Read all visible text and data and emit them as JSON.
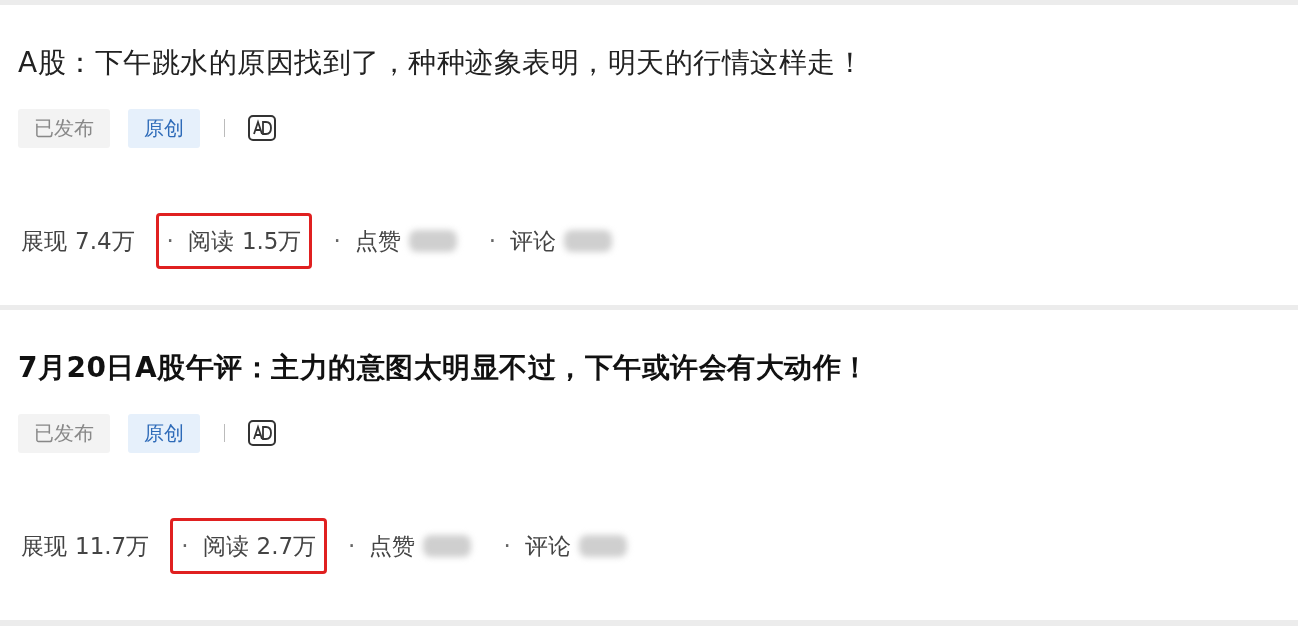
{
  "articles": [
    {
      "title": "A股：下午跳水的原因找到了，种种迹象表明，明天的行情这样走！",
      "bold": false,
      "tags": [
        {
          "label": "已发布",
          "kind": "status"
        },
        {
          "label": "原创",
          "kind": "original"
        }
      ],
      "ad": true,
      "stats": [
        {
          "label": "展现",
          "value": "7.4万",
          "highlighted": false,
          "blurred": false
        },
        {
          "separator": "·",
          "label": "阅读",
          "value": "1.5万",
          "highlighted": true,
          "blurred": false
        },
        {
          "separator": "·",
          "label": "点赞",
          "highlighted": false,
          "blurred": true
        },
        {
          "separator": "·",
          "label": "评论",
          "highlighted": false,
          "blurred": true
        }
      ]
    },
    {
      "title": "7月20日A股午评：主力的意图太明显不过，下午或许会有大动作！",
      "bold": true,
      "tags": [
        {
          "label": "已发布",
          "kind": "status"
        },
        {
          "label": "原创",
          "kind": "original"
        }
      ],
      "ad": true,
      "stats": [
        {
          "label": "展现",
          "value": "11.7万",
          "highlighted": false,
          "blurred": false
        },
        {
          "separator": "·",
          "label": "阅读",
          "value": "2.7万",
          "highlighted": true,
          "blurred": false
        },
        {
          "separator": "·",
          "label": "点赞",
          "highlighted": false,
          "blurred": true
        },
        {
          "separator": "·",
          "label": "评论",
          "highlighted": false,
          "blurred": true
        }
      ]
    }
  ]
}
